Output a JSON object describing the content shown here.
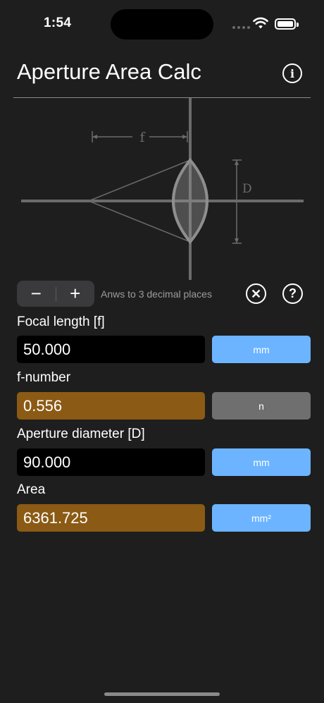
{
  "status": {
    "time": "1:54"
  },
  "header": {
    "title": "Aperture Area Calc"
  },
  "diagram": {
    "focal_label": "f",
    "diameter_label": "D"
  },
  "controls": {
    "minus": "−",
    "plus": "+",
    "precision_text": "Anws to 3 decimal places",
    "clear_symbol": "✕",
    "help_symbol": "?"
  },
  "fields": [
    {
      "label": "Focal length [f]",
      "value": "50.000",
      "unit": "mm"
    },
    {
      "label": "f-number",
      "value": "0.556",
      "unit": "n"
    },
    {
      "label": "Aperture diameter [D]",
      "value": "90.000",
      "unit": "mm"
    },
    {
      "label": "Area",
      "value": "6361.725",
      "unit": "mm²"
    }
  ],
  "colors": {
    "background": "#1e1e1e",
    "input_bg": "#000000",
    "result_bg": "#8b5a14",
    "unit_button": "#6cb4ff",
    "unit_button_inactive": "#6f6f6f"
  }
}
